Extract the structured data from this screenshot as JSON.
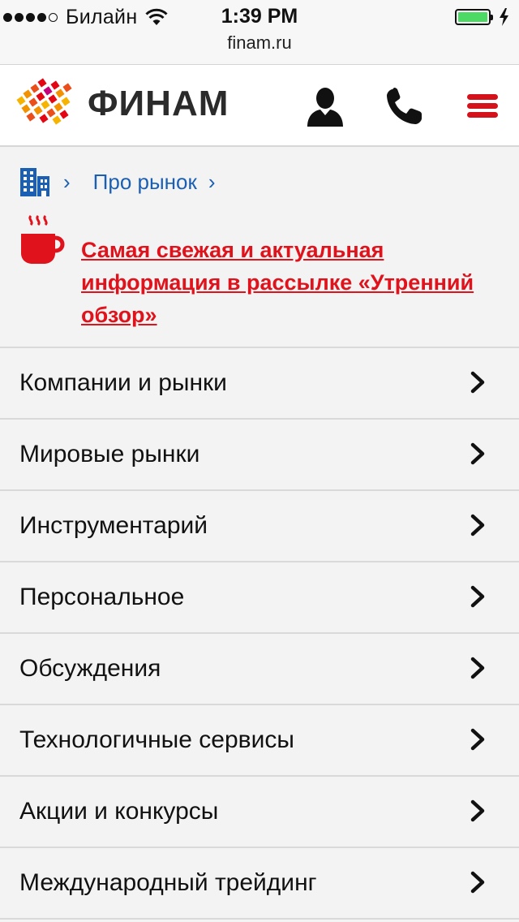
{
  "status_bar": {
    "carrier": "Билайн",
    "time": "1:39 PM",
    "url": "finam.ru",
    "signal_dots_filled": 4,
    "signal_dots_total": 5,
    "battery_level": 1.0
  },
  "header": {
    "logo_text": "ФИНАМ",
    "icons": [
      "user-icon",
      "phone-icon",
      "hamburger-menu-icon"
    ]
  },
  "breadcrumb": {
    "home_icon": "building-icon",
    "separator": "›",
    "items": [
      {
        "label": "Про рынок"
      }
    ]
  },
  "promo": {
    "icon": "coffee-cup-icon",
    "text": "Самая свежая и актуальная информация в рассылке «Утренний обзор»"
  },
  "menu": {
    "items": [
      {
        "label": "Компании и рынки"
      },
      {
        "label": "Мировые рынки"
      },
      {
        "label": "Инструментарий"
      },
      {
        "label": "Персональное"
      },
      {
        "label": "Обсуждения"
      },
      {
        "label": "Технологичные сервисы"
      },
      {
        "label": "Акции и конкурсы"
      },
      {
        "label": "Международный трейдинг"
      }
    ]
  },
  "colors": {
    "brand_red": "#e0121b",
    "link_blue": "#1a5fb4",
    "battery_green": "#4cd964",
    "background": "#f3f3f3"
  }
}
